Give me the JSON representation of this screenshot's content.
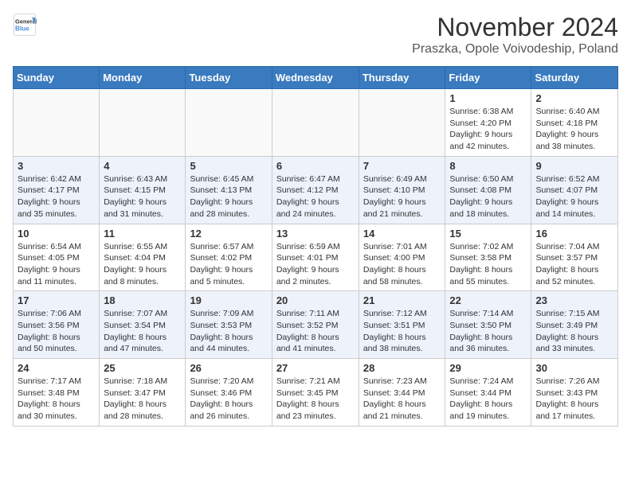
{
  "header": {
    "logo_general": "General",
    "logo_blue": "Blue",
    "title": "November 2024",
    "subtitle": "Praszka, Opole Voivodeship, Poland"
  },
  "columns": [
    "Sunday",
    "Monday",
    "Tuesday",
    "Wednesday",
    "Thursday",
    "Friday",
    "Saturday"
  ],
  "weeks": [
    [
      {
        "day": "",
        "info": ""
      },
      {
        "day": "",
        "info": ""
      },
      {
        "day": "",
        "info": ""
      },
      {
        "day": "",
        "info": ""
      },
      {
        "day": "",
        "info": ""
      },
      {
        "day": "1",
        "info": "Sunrise: 6:38 AM\nSunset: 4:20 PM\nDaylight: 9 hours and 42 minutes."
      },
      {
        "day": "2",
        "info": "Sunrise: 6:40 AM\nSunset: 4:18 PM\nDaylight: 9 hours and 38 minutes."
      }
    ],
    [
      {
        "day": "3",
        "info": "Sunrise: 6:42 AM\nSunset: 4:17 PM\nDaylight: 9 hours and 35 minutes."
      },
      {
        "day": "4",
        "info": "Sunrise: 6:43 AM\nSunset: 4:15 PM\nDaylight: 9 hours and 31 minutes."
      },
      {
        "day": "5",
        "info": "Sunrise: 6:45 AM\nSunset: 4:13 PM\nDaylight: 9 hours and 28 minutes."
      },
      {
        "day": "6",
        "info": "Sunrise: 6:47 AM\nSunset: 4:12 PM\nDaylight: 9 hours and 24 minutes."
      },
      {
        "day": "7",
        "info": "Sunrise: 6:49 AM\nSunset: 4:10 PM\nDaylight: 9 hours and 21 minutes."
      },
      {
        "day": "8",
        "info": "Sunrise: 6:50 AM\nSunset: 4:08 PM\nDaylight: 9 hours and 18 minutes."
      },
      {
        "day": "9",
        "info": "Sunrise: 6:52 AM\nSunset: 4:07 PM\nDaylight: 9 hours and 14 minutes."
      }
    ],
    [
      {
        "day": "10",
        "info": "Sunrise: 6:54 AM\nSunset: 4:05 PM\nDaylight: 9 hours and 11 minutes."
      },
      {
        "day": "11",
        "info": "Sunrise: 6:55 AM\nSunset: 4:04 PM\nDaylight: 9 hours and 8 minutes."
      },
      {
        "day": "12",
        "info": "Sunrise: 6:57 AM\nSunset: 4:02 PM\nDaylight: 9 hours and 5 minutes."
      },
      {
        "day": "13",
        "info": "Sunrise: 6:59 AM\nSunset: 4:01 PM\nDaylight: 9 hours and 2 minutes."
      },
      {
        "day": "14",
        "info": "Sunrise: 7:01 AM\nSunset: 4:00 PM\nDaylight: 8 hours and 58 minutes."
      },
      {
        "day": "15",
        "info": "Sunrise: 7:02 AM\nSunset: 3:58 PM\nDaylight: 8 hours and 55 minutes."
      },
      {
        "day": "16",
        "info": "Sunrise: 7:04 AM\nSunset: 3:57 PM\nDaylight: 8 hours and 52 minutes."
      }
    ],
    [
      {
        "day": "17",
        "info": "Sunrise: 7:06 AM\nSunset: 3:56 PM\nDaylight: 8 hours and 50 minutes."
      },
      {
        "day": "18",
        "info": "Sunrise: 7:07 AM\nSunset: 3:54 PM\nDaylight: 8 hours and 47 minutes."
      },
      {
        "day": "19",
        "info": "Sunrise: 7:09 AM\nSunset: 3:53 PM\nDaylight: 8 hours and 44 minutes."
      },
      {
        "day": "20",
        "info": "Sunrise: 7:11 AM\nSunset: 3:52 PM\nDaylight: 8 hours and 41 minutes."
      },
      {
        "day": "21",
        "info": "Sunrise: 7:12 AM\nSunset: 3:51 PM\nDaylight: 8 hours and 38 minutes."
      },
      {
        "day": "22",
        "info": "Sunrise: 7:14 AM\nSunset: 3:50 PM\nDaylight: 8 hours and 36 minutes."
      },
      {
        "day": "23",
        "info": "Sunrise: 7:15 AM\nSunset: 3:49 PM\nDaylight: 8 hours and 33 minutes."
      }
    ],
    [
      {
        "day": "24",
        "info": "Sunrise: 7:17 AM\nSunset: 3:48 PM\nDaylight: 8 hours and 30 minutes."
      },
      {
        "day": "25",
        "info": "Sunrise: 7:18 AM\nSunset: 3:47 PM\nDaylight: 8 hours and 28 minutes."
      },
      {
        "day": "26",
        "info": "Sunrise: 7:20 AM\nSunset: 3:46 PM\nDaylight: 8 hours and 26 minutes."
      },
      {
        "day": "27",
        "info": "Sunrise: 7:21 AM\nSunset: 3:45 PM\nDaylight: 8 hours and 23 minutes."
      },
      {
        "day": "28",
        "info": "Sunrise: 7:23 AM\nSunset: 3:44 PM\nDaylight: 8 hours and 21 minutes."
      },
      {
        "day": "29",
        "info": "Sunrise: 7:24 AM\nSunset: 3:44 PM\nDaylight: 8 hours and 19 minutes."
      },
      {
        "day": "30",
        "info": "Sunrise: 7:26 AM\nSunset: 3:43 PM\nDaylight: 8 hours and 17 minutes."
      }
    ]
  ]
}
